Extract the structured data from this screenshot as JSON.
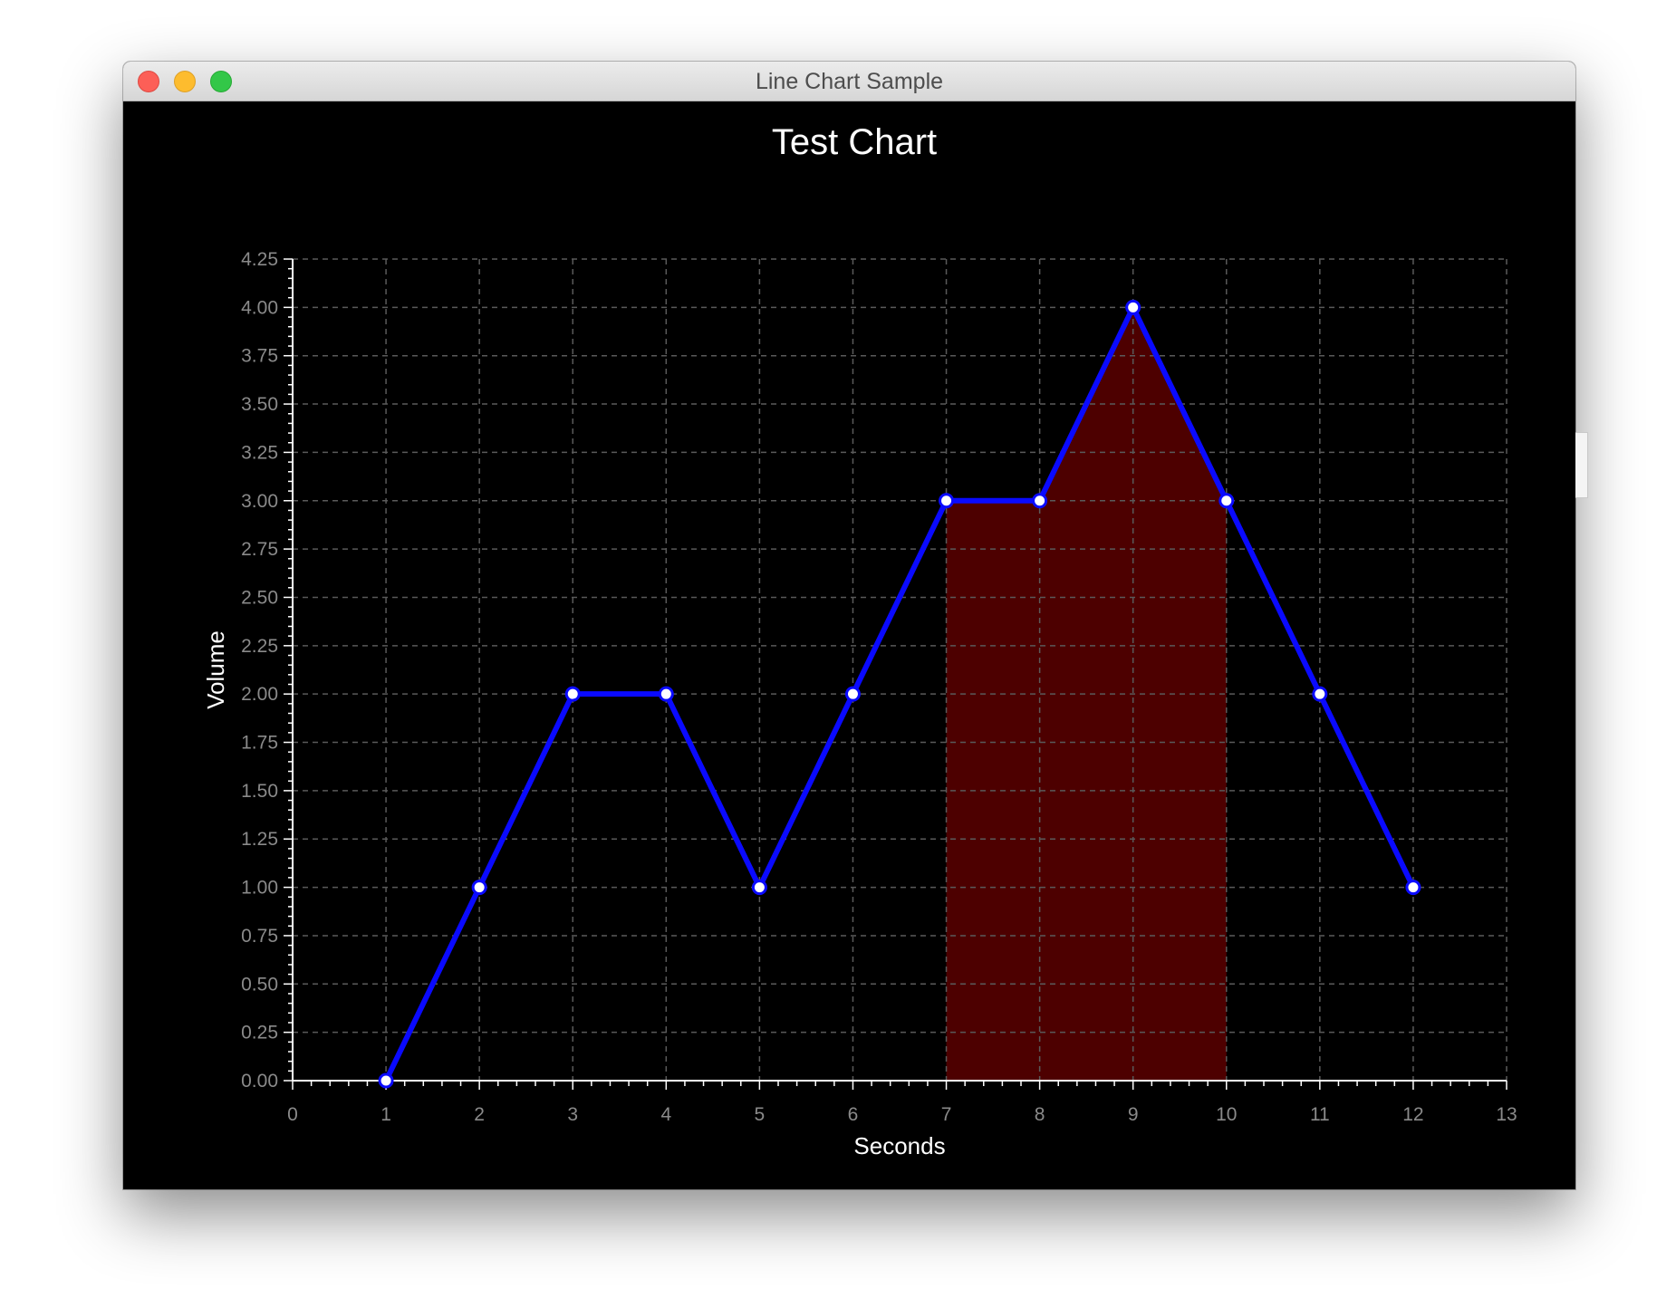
{
  "window": {
    "title": "Line Chart Sample"
  },
  "chart_data": {
    "type": "line",
    "title": "Test Chart",
    "xlabel": "Seconds",
    "ylabel": "Volume",
    "xlim": [
      0,
      13
    ],
    "ylim": [
      0,
      4.25
    ],
    "x_ticks": [
      "0",
      "1",
      "2",
      "3",
      "4",
      "5",
      "6",
      "7",
      "8",
      "9",
      "10",
      "11",
      "12",
      "13"
    ],
    "y_ticks": [
      "0.00",
      "0.25",
      "0.50",
      "0.75",
      "1.00",
      "1.25",
      "1.50",
      "1.75",
      "2.00",
      "2.25",
      "2.50",
      "2.75",
      "3.00",
      "3.25",
      "3.50",
      "3.75",
      "4.00",
      "4.25"
    ],
    "grid": true,
    "series": [
      {
        "x": [
          1,
          2,
          3,
          4,
          5,
          6,
          7,
          8,
          9,
          10,
          11,
          12
        ],
        "y": [
          0,
          1,
          2,
          2,
          1,
          2,
          3,
          3,
          4,
          3,
          2,
          1
        ]
      }
    ],
    "highlight_range": [
      7,
      10
    ],
    "colors": {
      "background": "#000000",
      "line": "#0a0aff",
      "marker_fill": "#ffffff",
      "highlight_fill": "#4d0000",
      "grid": "#5a5a5a",
      "tick_text": "#8a8a8a",
      "label_text": "#ffffff"
    }
  }
}
